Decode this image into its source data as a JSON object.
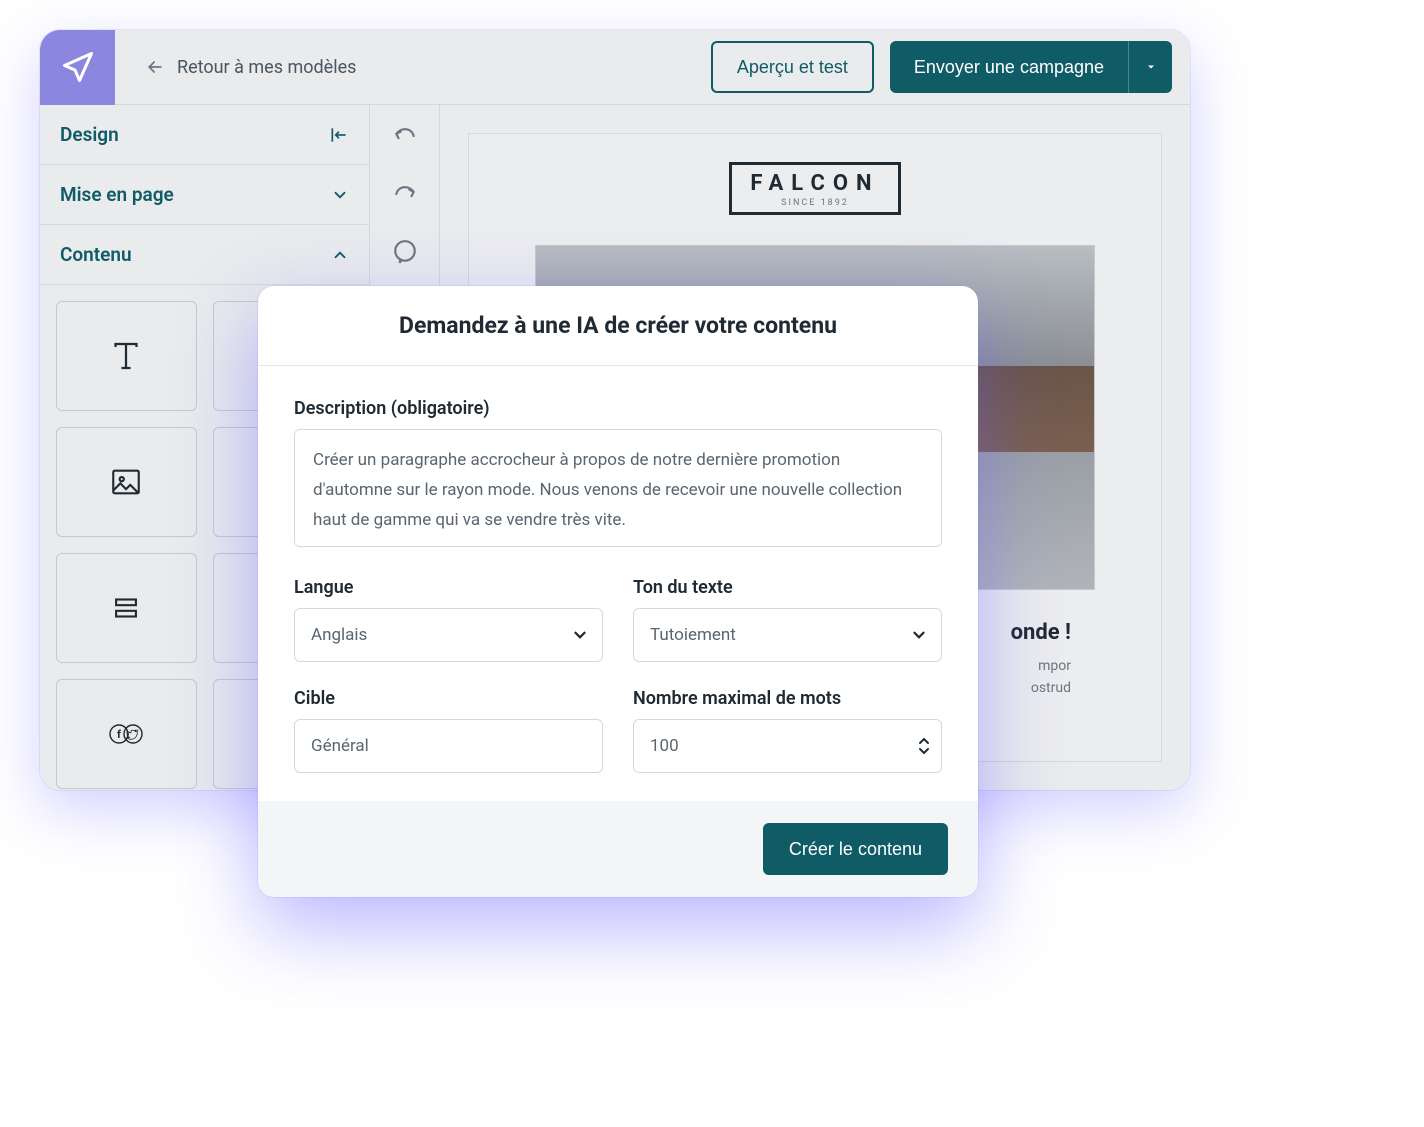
{
  "topbar": {
    "back_label": "Retour à mes modèles",
    "preview_label": "Aperçu et test",
    "send_label": "Envoyer une campagne"
  },
  "sidebar": {
    "design_label": "Design",
    "layout_label": "Mise en page",
    "content_label": "Contenu"
  },
  "email": {
    "brand_name": "FALCON",
    "brand_since": "SINCE 1892",
    "hero_title_fragment": "onde !",
    "hero_text_line1": "mpor",
    "hero_text_line2": "ostrud"
  },
  "modal": {
    "title": "Demandez à une IA de créer votre contenu",
    "description_label": "Description (obligatoire)",
    "description_value": "Créer un paragraphe accrocheur à propos de notre dernière promotion d'automne sur le rayon mode. Nous venons de recevoir une nouvelle collection haut de gamme qui va se vendre très vite.",
    "language_label": "Langue",
    "language_value": "Anglais",
    "tone_label": "Ton du texte",
    "tone_value": "Tutoiement",
    "target_label": "Cible",
    "target_value": "Général",
    "maxwords_label": "Nombre maximal de mots",
    "maxwords_value": "100",
    "create_label": "Créer le contenu"
  }
}
